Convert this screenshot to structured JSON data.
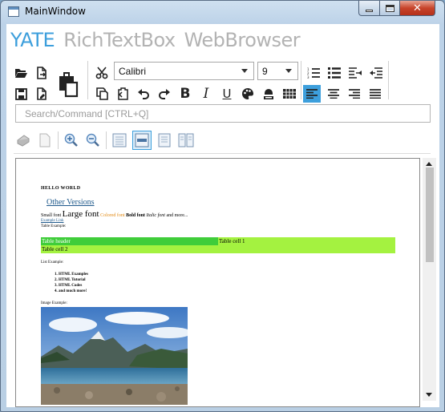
{
  "window": {
    "title": "MainWindow"
  },
  "tabs": [
    {
      "label": "YATE",
      "active": true
    },
    {
      "label": "RichTextBox",
      "active": false
    },
    {
      "label": "WebBrowser",
      "active": false
    }
  ],
  "ribbon": {
    "font_family": "Calibri",
    "font_size": "9",
    "icons": [
      "open-folder-icon",
      "open-file-icon",
      "save-icon",
      "save-as-icon",
      "paste-icon",
      "cut-icon",
      "copy-icon",
      "paste-special-icon",
      "undo-icon",
      "redo-icon",
      "bold-icon",
      "italic-icon",
      "underline-icon",
      "color-palette-icon",
      "highlight-icon",
      "table-icon",
      "numbered-list-icon",
      "bullet-list-icon",
      "indent-increase-icon",
      "indent-decrease-icon",
      "align-left-icon",
      "align-center-icon",
      "align-right-icon",
      "align-justify-icon"
    ],
    "bold_label": "B",
    "italic_label": "I",
    "underline_label": "U"
  },
  "search": {
    "placeholder": "Search/Command [CTRL+Q]",
    "value": ""
  },
  "view_toolbar": {
    "icons": [
      "print-icon",
      "page-icon",
      "zoom-in-icon",
      "zoom-out-icon",
      "fit-width-icon",
      "fit-page-icon",
      "single-page-icon",
      "two-page-icon"
    ]
  },
  "document": {
    "heading": "HELLO WORLD",
    "other_versions": "Other Versions",
    "small_font": "Small font",
    "large_font": "Large font",
    "colored_font": "Colored font",
    "bold_font": "Bold font",
    "italic_font": "Italic font",
    "and_more": "and more...",
    "example_link": "Example Link",
    "table_example": "Table Example:",
    "table": {
      "header": "Table header",
      "cell1": "Table cell 1",
      "cell2": "Table cell 2"
    },
    "list_example": "List Example:",
    "list_items": [
      "HTML Examples",
      "HTML Tutorial",
      "HTML Codes",
      "and much more!"
    ],
    "image_example": "Image Example:"
  },
  "colors": {
    "accent": "#3d9fdc",
    "link": "#1f5a8c",
    "table_header_bg": "#3fcd3a",
    "table_cell_bg": "#a4f240",
    "colored_font": "#e28a14"
  }
}
